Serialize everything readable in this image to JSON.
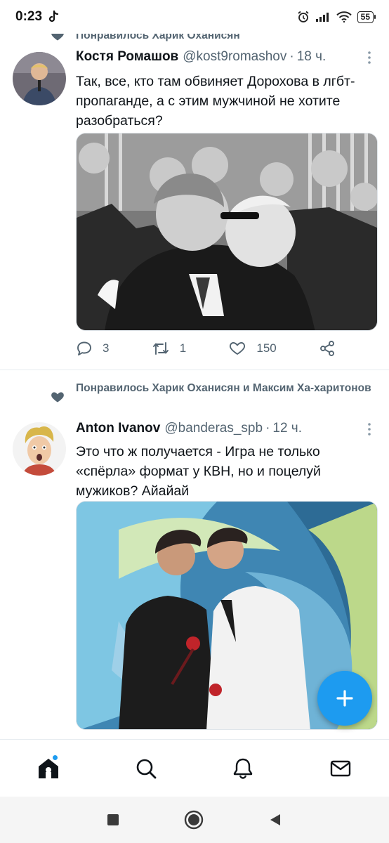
{
  "status_bar": {
    "time": "0:23",
    "battery": "55"
  },
  "tweets": [
    {
      "social_context": "Понравилось Харик Оханисян",
      "name": "Костя Ромашов",
      "handle": "@kost9romashov",
      "dot": "·",
      "time": "18 ч.",
      "text": "Так, все, кто там обвиняет Дорохова в лгбт-пропаганде, а с этим мужчиной не хотите разобраться?",
      "replies": "3",
      "retweets": "1",
      "likes": "150"
    },
    {
      "social_context": "Понравилось Харик Оханисян и Максим Ха-харитонов",
      "name": "Anton Ivanov",
      "handle": "@banderas_spb",
      "dot": "·",
      "time": "12 ч.",
      "text": "Это что ж получается - Игра не только «спёрла» формат у КВН, но и поцелуй мужиков? Айайай"
    }
  ],
  "colors": {
    "accent": "#1d9bf0",
    "secondary_text": "#536471",
    "primary_text": "#0f1419"
  },
  "icons": {
    "nav": [
      "home-icon",
      "search-icon",
      "notifications-icon",
      "messages-icon"
    ],
    "actions": [
      "reply-icon",
      "retweet-icon",
      "like-icon",
      "share-icon"
    ],
    "fab": "compose-plus-icon",
    "system": [
      "recents-square-icon",
      "home-circle-icon",
      "back-triangle-icon"
    ]
  }
}
